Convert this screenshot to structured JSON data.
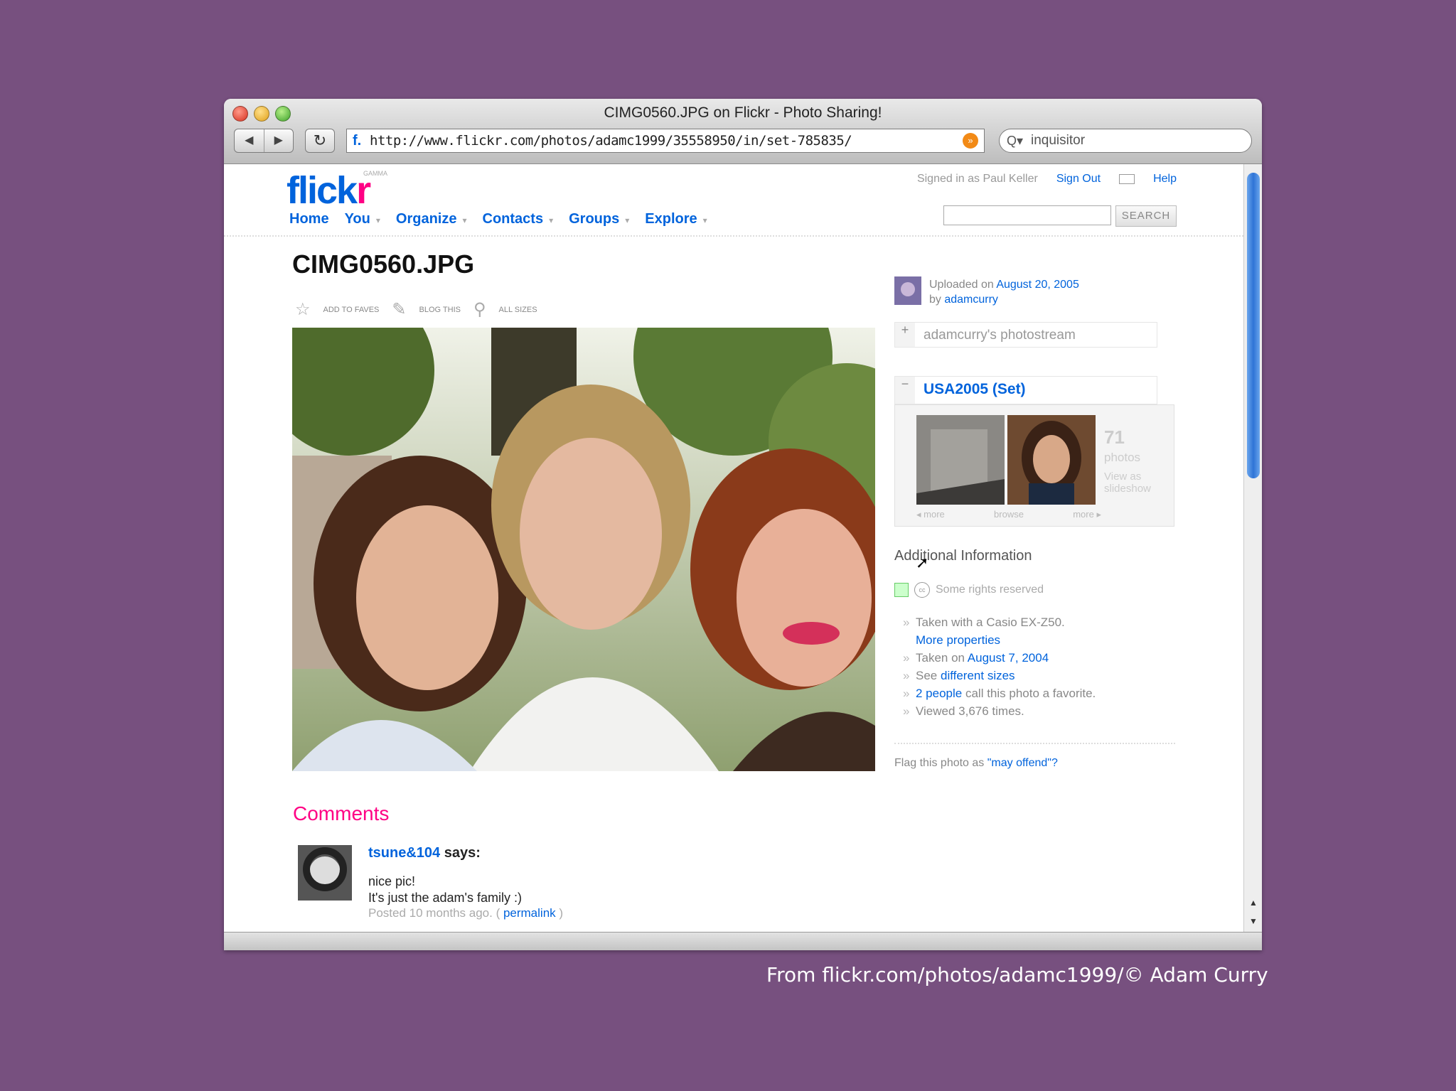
{
  "window": {
    "title": "CIMG0560.JPG on Flickr - Photo Sharing!",
    "url": "http://www.flickr.com/photos/adamc1999/35558950/in/set-785835/",
    "search_value": "inquisitor",
    "back_label": "◀",
    "forward_label": "▶",
    "reload_label": "↻",
    "favicon": "f.",
    "rss_label": "»",
    "search_icon": "Q▾"
  },
  "header": {
    "logo_flick": "flick",
    "logo_r": "r",
    "logo_gamma": "GAMMA",
    "signed_in": "Signed in as Paul Keller",
    "sign_out": "Sign Out",
    "help": "Help",
    "nav": [
      "Home",
      "You",
      "Organize",
      "Contacts",
      "Groups",
      "Explore"
    ],
    "search_button": "SEARCH"
  },
  "photo": {
    "title": "CIMG0560.JPG",
    "tools": [
      "ADD TO FAVES",
      "BLOG THIS",
      "ALL SIZES"
    ]
  },
  "sidebar": {
    "uploaded_prefix": "Uploaded on ",
    "uploaded_date": "August 20, 2005",
    "by_prefix": "by ",
    "by_user": "adamcurry",
    "photostream": "adamcurry's photostream",
    "set_name": "USA2005 (Set)",
    "set_count": "71",
    "set_photos_label": "photos",
    "set_slideshow": "View as slideshow",
    "set_nav": [
      "◂ more",
      "browse",
      "more ▸"
    ],
    "additional_info_title": "Additional Information",
    "license": "Some rights reserved",
    "taken_with": "Taken with a Casio EX-Z50.",
    "more_properties": "More properties",
    "taken_on_prefix": "Taken on ",
    "taken_on_date": "August 7, 2004",
    "see_prefix": "See ",
    "different_sizes": "different sizes",
    "fav_people": "2 people",
    "fav_suffix": " call this photo a favorite.",
    "viewed": "Viewed 3,676 times.",
    "flag_prefix": "Flag this photo as ",
    "flag_link": "\"may offend\"?"
  },
  "comments": {
    "title": "Comments",
    "items": [
      {
        "user": "tsune&104",
        "says": " says:",
        "line1": "nice pic!",
        "line2": "It's just the adam's family :)",
        "posted": "Posted 10 months ago. ( ",
        "permalink": "permalink",
        "close": " )"
      }
    ]
  },
  "caption": "From flickr.com/photos/adamc1999/© Adam Curry",
  "colors": {
    "background": "#77507f",
    "flickr_blue": "#0063dc",
    "flickr_pink": "#ff0084"
  }
}
